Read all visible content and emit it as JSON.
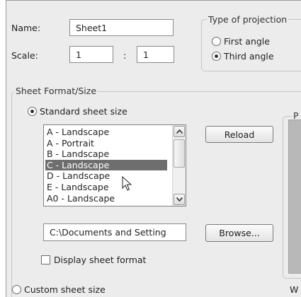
{
  "properties": {
    "name_label": "Name:",
    "name_value": "Sheet1",
    "scale_label": "Scale:",
    "scale_numerator": "1",
    "scale_separator": ":",
    "scale_denominator": "1"
  },
  "projection": {
    "legend": "Type of projection",
    "options": [
      {
        "label": "First angle",
        "checked": false
      },
      {
        "label": "Third angle",
        "checked": true
      }
    ]
  },
  "sheet_format": {
    "legend": "Sheet Format/Size",
    "standard_label": "Standard sheet size",
    "sizes": [
      "A - Landscape",
      "A - Portrait",
      "B - Landscape",
      "C - Landscape",
      "D - Landscape",
      "E - Landscape",
      "A0 - Landscape"
    ],
    "selected_size": "C - Landscape",
    "reload_label": "Reload",
    "path_value": "C:\\Documents and Setting",
    "browse_label": "Browse...",
    "display_format_label": "Display sheet format",
    "custom_label": "Custom sheet size"
  },
  "preview": {
    "label_fragment": "P",
    "width_label_fragment": "W"
  }
}
